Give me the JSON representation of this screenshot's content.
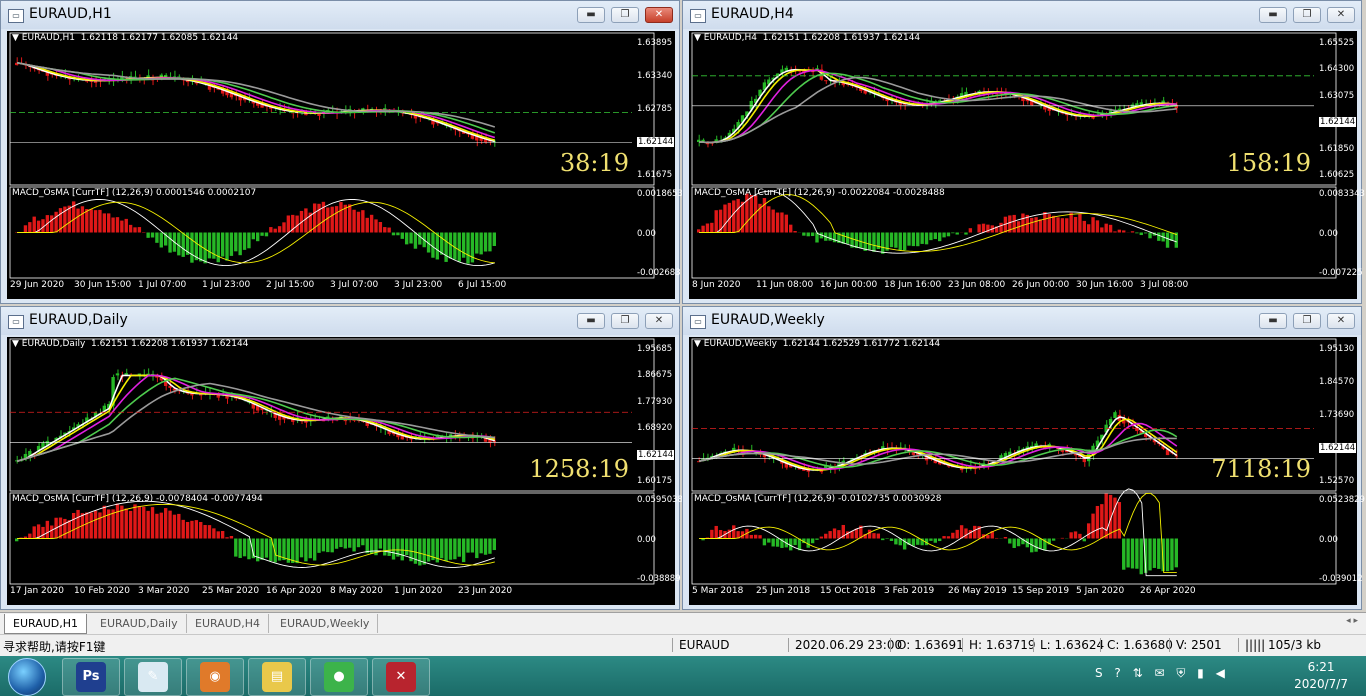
{
  "windows": [
    {
      "title": "EURAUD,H1",
      "info": "EURAUD,H1  1.62118 1.62177 1.62085 1.62144",
      "macd": "MACD_OsMA [CurrTF] (12,26,9) 0.0001546 0.0002107",
      "countdown": "38:19",
      "price_labels": [
        "1.63895",
        "1.63340",
        "1.62785",
        "1.62144",
        "1.61675"
      ],
      "macd_labels": [
        "0.0018653",
        "0.00",
        "-0.002683"
      ],
      "time_labels": [
        "29 Jun 2020",
        "30 Jun 15:00",
        "1 Jul 07:00",
        "1 Jul 23:00",
        "2 Jul 15:00",
        "3 Jul 07:00",
        "3 Jul 23:00",
        "6 Jul 15:00"
      ],
      "close_active": true
    },
    {
      "title": "EURAUD,H4",
      "info": "EURAUD,H4  1.62151 1.62208 1.61937 1.62144",
      "macd": "MACD_OsMA [CurrTF] (12,26,9) -0.0022084 -0.0028488",
      "countdown": "158:19",
      "price_labels": [
        "1.65525",
        "1.64300",
        "1.63075",
        "1.62144",
        "1.61850",
        "1.60625"
      ],
      "macd_labels": [
        "0.0083343",
        "0.00",
        "-0.007225"
      ],
      "time_labels": [
        "8 Jun 2020",
        "11 Jun 08:00",
        "16 Jun 00:00",
        "18 Jun 16:00",
        "23 Jun 08:00",
        "26 Jun 00:00",
        "30 Jun 16:00",
        "3 Jul 08:00"
      ],
      "close_active": false
    },
    {
      "title": "EURAUD,Daily",
      "info": "EURAUD,Daily  1.62151 1.62208 1.61937 1.62144",
      "macd": "MACD_OsMA [CurrTF] (12,26,9) -0.0078404 -0.0077494",
      "countdown": "1258:19",
      "price_labels": [
        "1.95685",
        "1.86675",
        "1.77930",
        "1.68920",
        "1.62144",
        "1.60175"
      ],
      "macd_labels": [
        "0.0595038",
        "0.00",
        "-0.038889"
      ],
      "time_labels": [
        "17 Jan 2020",
        "10 Feb 2020",
        "3 Mar 2020",
        "25 Mar 2020",
        "16 Apr 2020",
        "8 May 2020",
        "1 Jun 2020",
        "23 Jun 2020"
      ],
      "close_active": false
    },
    {
      "title": "EURAUD,Weekly",
      "info": "EURAUD,Weekly  1.62144 1.62529 1.61772 1.62144",
      "macd": "MACD_OsMA [CurrTF] (12,26,9) -0.0102735 0.0030928",
      "countdown": "7118:19",
      "price_labels": [
        "1.95130",
        "1.84570",
        "1.73690",
        "1.62144",
        "1.52570"
      ],
      "macd_labels": [
        "0.0523829",
        "0.00",
        "-0.039012"
      ],
      "time_labels": [
        "5 Mar 2018",
        "25 Jun 2018",
        "15 Oct 2018",
        "3 Feb 2019",
        "26 May 2019",
        "15 Sep 2019",
        "5 Jan 2020",
        "26 Apr 2020"
      ],
      "close_active": false
    }
  ],
  "tabs": [
    "EURAUD,H1",
    "EURAUD,Daily",
    "EURAUD,H4",
    "EURAUD,Weekly"
  ],
  "active_tab": "EURAUD,H1",
  "status": {
    "help": "寻求帮助,请按F1键",
    "symbol": "EURAUD",
    "datetime": "2020.06.29 23:00",
    "open": "O: 1.63691",
    "high": "H: 1.63719",
    "low": "L: 1.63624",
    "close": "C: 1.63680",
    "volume": "V: 2501",
    "traffic": "105/3 kb"
  },
  "taskbar": {
    "apps": [
      {
        "name": "photoshop",
        "glyph": "Ps",
        "color": "#1f3f8f"
      },
      {
        "name": "paint",
        "glyph": "✎",
        "color": "#d9e9f2"
      },
      {
        "name": "firefox",
        "glyph": "◉",
        "color": "#e07a2a"
      },
      {
        "name": "explorer",
        "glyph": "▤",
        "color": "#e9c84a"
      },
      {
        "name": "wechat",
        "glyph": "●",
        "color": "#3cb34a"
      },
      {
        "name": "metatrader",
        "glyph": "✕",
        "color": "#b8242e"
      }
    ],
    "time": "6:21",
    "date": "2020/7/7"
  },
  "colors": {
    "bull": "#26b826",
    "bear": "#e01818",
    "ma_white": "#ffffff",
    "ma_yellow": "#f5f000",
    "ma_magenta": "#e020e0",
    "ma_green": "#4ecb4e",
    "ma_gray": "#9a9a9a"
  }
}
